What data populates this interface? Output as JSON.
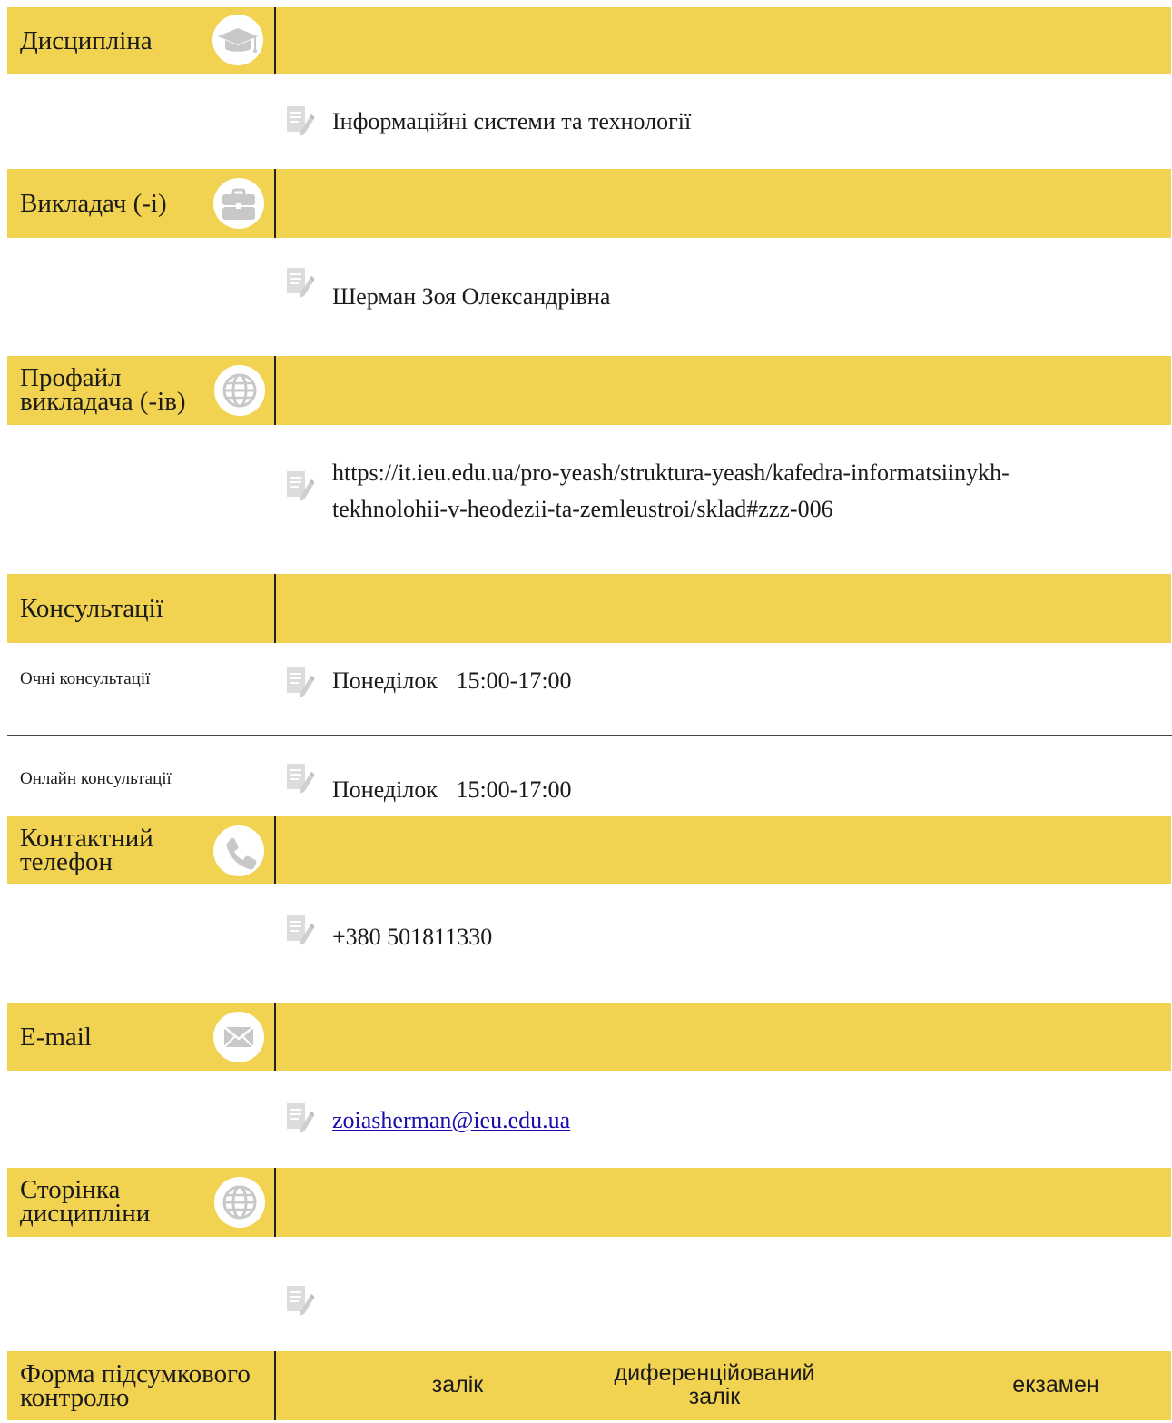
{
  "discipline": {
    "label": "Дисципліна",
    "icon": "graduation-cap-icon",
    "value": "Інформаційні системи та технології"
  },
  "teacher": {
    "label": "Викладач (-і)",
    "icon": "briefcase-icon",
    "value": "Шерман Зоя Олександрівна"
  },
  "teacher_profile": {
    "label_line1": "Профайл",
    "label_line2": "викладача (-ів)",
    "icon": "globe-icon",
    "url_line1": "https://it.ieu.edu.ua/pro-yeash/struktura-yeash/kafedra-informatsiinykh-",
    "url_line2": "tekhnolohii-v-heodezii-ta-zemleustroi/sklad#zzz-006"
  },
  "consultations": {
    "label": "Консультації",
    "in_person": {
      "label": "Очні консультації",
      "day": "Понеділок",
      "time": "15:00-17:00"
    },
    "online": {
      "label": "Онлайн консультації",
      "day": "Понеділок",
      "time": "15:00-17:00"
    }
  },
  "phone": {
    "label_line1": "Контактний",
    "label_line2": "телефон",
    "icon": "phone-icon",
    "value": "+380 501811330"
  },
  "email": {
    "label": "E-mail",
    "icon": "envelope-icon",
    "value": "zoiasherman@ieu.edu.ua"
  },
  "course_page": {
    "label_line1": "Сторінка",
    "label_line2": "дисципліни",
    "icon": "globe-icon",
    "value": ""
  },
  "final_control": {
    "label_line1": "Форма підсумкового",
    "label_line2": "контролю",
    "options": {
      "credit": "залік",
      "diff_credit_line1": "диференційований",
      "diff_credit_line2": "залік",
      "exam": "екзамен"
    }
  },
  "colors": {
    "band": "#f2d351",
    "icon_circle": "#ffffff",
    "icon_glyph": "#c8c8c8",
    "link": "#1a0dab"
  }
}
